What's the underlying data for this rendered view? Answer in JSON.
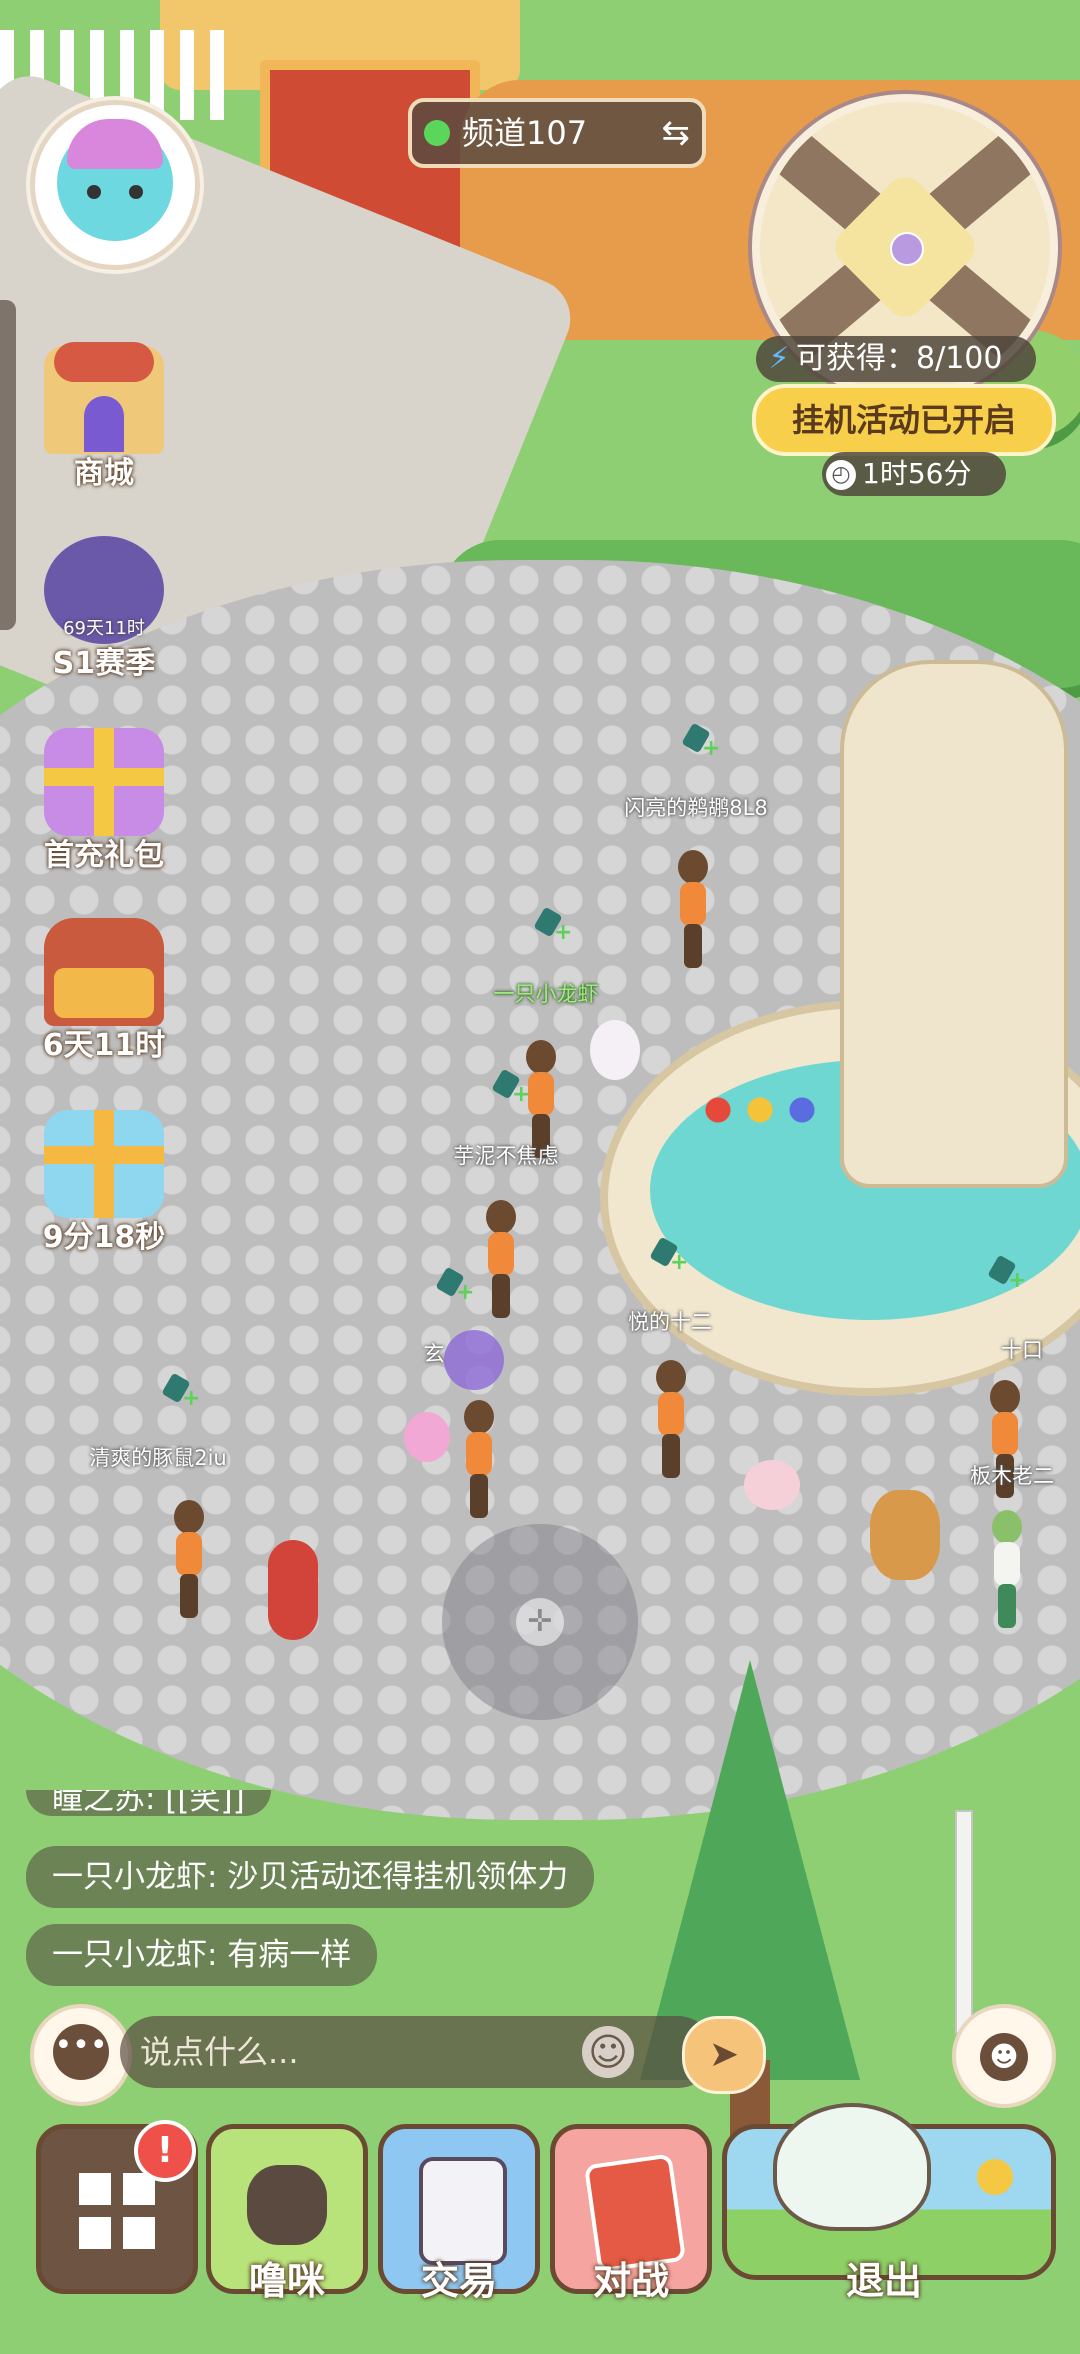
{
  "channel": {
    "label": "频道107",
    "status_color": "#5bd65b"
  },
  "minimap": {
    "reward_text": "可获得：8/100"
  },
  "idle_event": {
    "banner": "挂机活动已开启",
    "timer": "1时56分"
  },
  "side_menu": {
    "shop": "商城",
    "season": {
      "label": "S1赛季",
      "timer": "69天11时"
    },
    "first_recharge": "首充礼包",
    "chest_timer": "6天11时",
    "gift_timer": "9分18秒"
  },
  "players": [
    {
      "name": "闪亮的鹈鹕8L8"
    },
    {
      "name": "一只小龙虾"
    },
    {
      "name": "芋泥不焦虑"
    },
    {
      "name": "悦的十二"
    },
    {
      "name": "十口"
    },
    {
      "name": "板木老二"
    },
    {
      "name": "清爽的豚鼠2iu"
    },
    {
      "name": "玄"
    }
  ],
  "chat": {
    "partial": "瞳之苏: [[笑]]",
    "messages": [
      "一只小龙虾: 沙贝活动还得挂机领体力",
      "一只小龙虾: 有病一样"
    ],
    "placeholder": "说点什么..."
  },
  "bottom_bar": {
    "pet": "噜咪",
    "trade": "交易",
    "battle": "对战",
    "exit": "退出",
    "alert_badge": "!"
  },
  "icons": {
    "more": "ellipsis-icon",
    "emoji": "smiley-icon",
    "send": "send-icon",
    "emote": "emote-icon",
    "swap": "swap-icon",
    "clock": "clock-icon",
    "energy": "lightning-icon"
  }
}
